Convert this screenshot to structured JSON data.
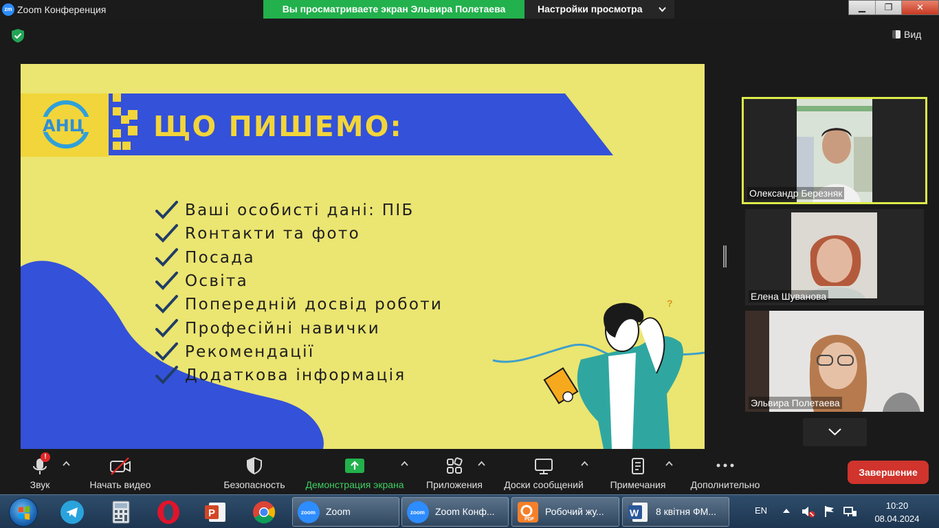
{
  "titlebar": {
    "app_logo": "zm",
    "app_title": "Zoom Конференция",
    "share_banner": "Вы просматриваете экран Эльвира Полетаева",
    "view_settings": "Настройки просмотра",
    "minimize": "▁",
    "maximize": "❐",
    "close": "✕"
  },
  "meeting": {
    "view_label": "Вид"
  },
  "slide": {
    "logo_text": "АНЦ",
    "title": "ЩО ПИШЕМО:",
    "bullets": [
      "Ваші особисті дані: ПІБ",
      "Rонтакти та фото",
      "Посада",
      "Освіта",
      "Попередній досвід роботи",
      "Професійні навички",
      "Рекомендації",
      "Додаткова інформація"
    ],
    "question_mark": "?",
    "colors": {
      "background": "#ebe571",
      "blue": "#3451d9",
      "yellow": "#f2d53a",
      "check": "#1f3d66"
    }
  },
  "participants": [
    {
      "name": "Олександр  Березняк"
    },
    {
      "name": "Елена Шуванова"
    },
    {
      "name": "Эльвира Полетаева"
    }
  ],
  "toolbar": {
    "audio": "Звук",
    "audio_badge": "!",
    "video": "Начать видео",
    "security": "Безопасность",
    "share": "Демонстрация экрана",
    "apps": "Приложения",
    "whiteboards": "Доски сообщений",
    "notes": "Примечания",
    "more": "Дополнительно",
    "end": "Завершение",
    "share_color": "#22b14c"
  },
  "taskbar": {
    "tasks": [
      {
        "label": "Zoom"
      },
      {
        "label": "Zoom Конф..."
      },
      {
        "label": "Робочий жу..."
      },
      {
        "label": "8 квітня ФМ..."
      }
    ],
    "pdf_label": "PDF",
    "lang": "EN",
    "time": "10:20",
    "date": "08.04.2024"
  }
}
